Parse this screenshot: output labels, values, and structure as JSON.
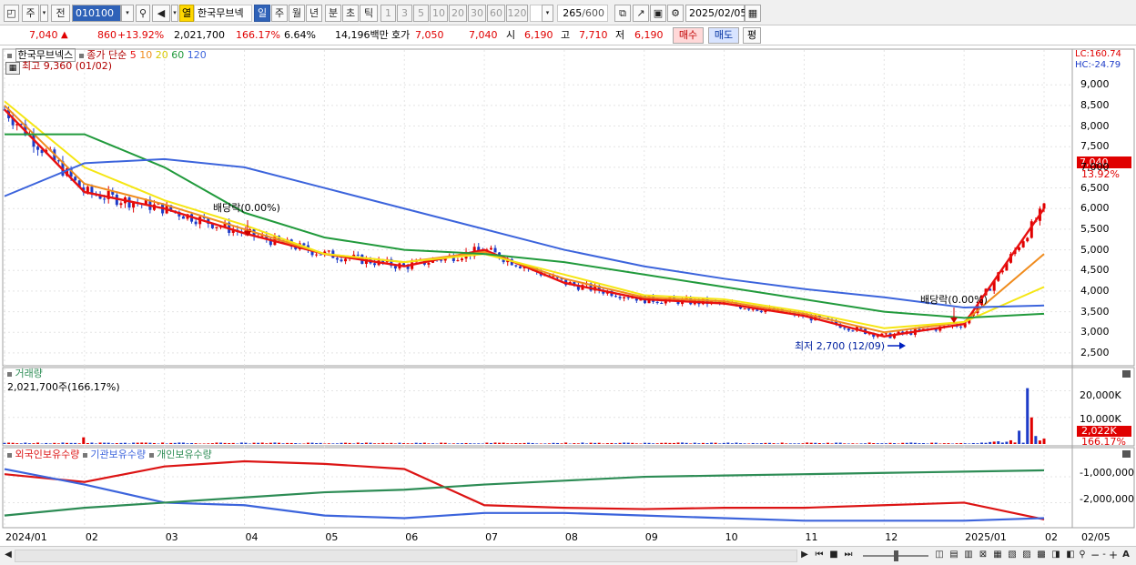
{
  "toolbar": {
    "type_select": "주",
    "prev_label": "전",
    "code_value": "010100",
    "stock_name": "한국무브넥",
    "yeol_label": "열",
    "periods": [
      "일",
      "주",
      "월",
      "년",
      "분",
      "초",
      "틱"
    ],
    "selected_period": "일",
    "intervals": [
      "1",
      "3",
      "5",
      "10",
      "20",
      "30",
      "60",
      "120"
    ],
    "count": "265",
    "total": "/600",
    "date": "2025/02/05"
  },
  "quote": {
    "price": "7,040",
    "up_arrow": "▲",
    "change": "860",
    "change_pct": "+13.92%",
    "volume": "2,021,700",
    "volume_ratio": "166.17%",
    "turnover": "6.64%",
    "amount": "14,196백만",
    "ask_label": "호가",
    "ask": "7,050",
    "bid": "7,040",
    "open_label": "시",
    "open": "6,190",
    "high_label": "고",
    "high": "7,710",
    "low_label": "저",
    "low": "6,190",
    "buy_label": "매수",
    "sell_label": "매도",
    "eval_label": "평"
  },
  "price_panel": {
    "legend_name": "한국무브넥스",
    "ma_label": "종가 단순",
    "ma_periods": [
      "5",
      "10",
      "20",
      "60",
      "120"
    ],
    "high_note": "최고 9,360 (01/02)",
    "low_note": "최저 2,700 (12/09)",
    "div1": "배당락(0.00%)",
    "div2": "배당락(0.00%)",
    "lc": "LC:160.74",
    "hc": "HC:-24.79",
    "last_price": "7,040",
    "last_pct": "13.92%",
    "y_ticks": [
      "9,000",
      "8,500",
      "8,000",
      "7,500",
      "7,000",
      "6,500",
      "6,000",
      "5,500",
      "5,000",
      "4,500",
      "4,000",
      "3,500",
      "3,000",
      "2,500"
    ]
  },
  "volume_panel": {
    "title": "거래량",
    "value": "2,021,700주(166.17%)",
    "y_ticks": [
      "20,000K",
      "10,000K"
    ],
    "last_value": "2,022K",
    "last_pct": "166.17%"
  },
  "holding_panel": {
    "series_labels": [
      "외국인보유수량",
      "기관보유수량",
      "개인보유수량"
    ],
    "y_ticks": [
      "-1,000,000",
      "-2,000,000"
    ]
  },
  "x_axis": {
    "labels": [
      "2024/01",
      "02",
      "03",
      "04",
      "05",
      "06",
      "07",
      "08",
      "09",
      "10",
      "11",
      "12",
      "2025/01",
      "02",
      "02/05"
    ]
  },
  "colors": {
    "up": "#e00000",
    "down": "#1e3cc8",
    "ma5": "#e81010",
    "ma10": "#f08c1e",
    "ma20": "#f5e614",
    "ma60": "#219a3c",
    "ma120": "#3c64dc",
    "foreign": "#dc1414",
    "institution": "#3c64dc",
    "individual": "#2d8c55"
  },
  "chart_data": [
    {
      "type": "line",
      "title": "",
      "x": [
        "2024/01",
        "02",
        "03",
        "04",
        "05",
        "06",
        "07",
        "08",
        "09",
        "10",
        "11",
        "12",
        "2025/01",
        "02"
      ],
      "series": [
        {
          "name": "5",
          "values": [
            8400,
            6400,
            6000,
            5400,
            4900,
            4600,
            5000,
            4200,
            3800,
            3700,
            3400,
            2900,
            3200,
            6000
          ]
        },
        {
          "name": "10",
          "values": [
            8500,
            6600,
            6100,
            5500,
            4900,
            4700,
            4950,
            4300,
            3850,
            3750,
            3450,
            3000,
            3250,
            4900
          ]
        },
        {
          "name": "20",
          "values": [
            8600,
            7000,
            6200,
            5600,
            4900,
            4700,
            4900,
            4400,
            3900,
            3800,
            3500,
            3100,
            3250,
            4100
          ]
        },
        {
          "name": "60",
          "values": [
            7800,
            7800,
            7000,
            5900,
            5300,
            5000,
            4900,
            4700,
            4400,
            4100,
            3800,
            3500,
            3350,
            3450
          ]
        },
        {
          "name": "120",
          "values": [
            6300,
            7100,
            7200,
            7000,
            6500,
            6000,
            5500,
            5000,
            4600,
            4300,
            4050,
            3850,
            3600,
            3650
          ]
        }
      ],
      "ylim": [
        2300,
        9600
      ]
    },
    {
      "type": "bar",
      "title": "거래량",
      "values_k": [
        20,
        21000,
        10000,
        2022
      ],
      "ylim": [
        0,
        26000
      ]
    },
    {
      "type": "line",
      "title": "",
      "series": [
        {
          "name": "외국인보유수량",
          "values": [
            -900000,
            -1200000,
            -600000,
            -400000,
            -500000,
            -700000,
            -2100000,
            -2200000,
            -2250000,
            -2200000,
            -2200000,
            -2100000,
            -2000000,
            -2650000
          ]
        },
        {
          "name": "기관보유수량",
          "values": [
            -700000,
            -1300000,
            -2000000,
            -2100000,
            -2500000,
            -2600000,
            -2400000,
            -2400000,
            -2500000,
            -2600000,
            -2700000,
            -2700000,
            -2700000,
            -2600000
          ]
        },
        {
          "name": "개인보유수량",
          "values": [
            -2500000,
            -2200000,
            -2000000,
            -1800000,
            -1600000,
            -1500000,
            -1300000,
            -1150000,
            -1000000,
            -950000,
            -900000,
            -850000,
            -800000,
            -750000
          ]
        }
      ],
      "ylim": [
        -2900000,
        -400000
      ]
    }
  ]
}
